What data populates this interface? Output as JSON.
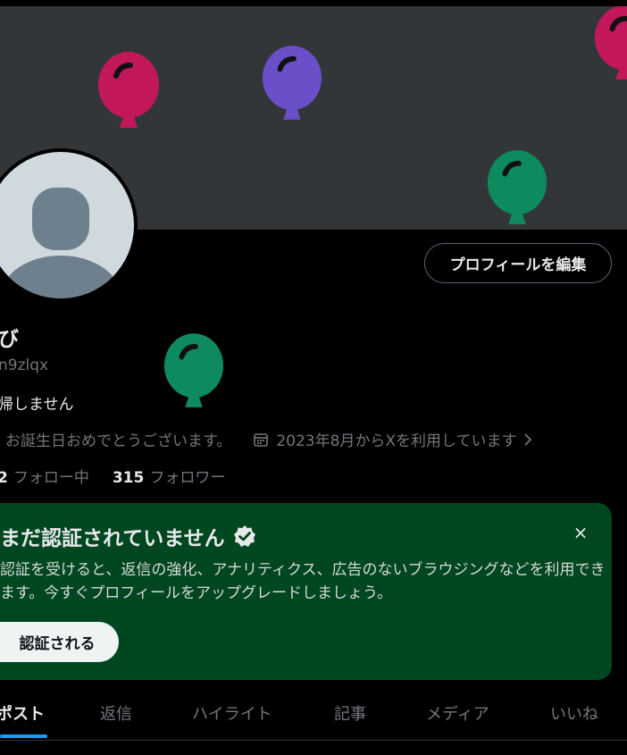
{
  "profile": {
    "display_name": "び",
    "handle": "n9zlqx",
    "bio": "帰しません",
    "edit_profile_label": "プロフィールを編集",
    "birthday_text": "お誕生日おめでとうございます。",
    "joined_text": "2023年8月からXを利用しています",
    "following_count": "2",
    "following_label": "フォロー中",
    "followers_count": "315",
    "followers_label": "フォロワー"
  },
  "verify_card": {
    "title": "まだ認証されていません",
    "description": "認証を受けると、返信の強化、アナリティクス、広告のないブラウジングなどを利用できます。今すぐプロフィールをアップグレードしましょう。",
    "button_label": "認証される",
    "close_icon": "×"
  },
  "tabs": [
    {
      "label": "ポスト",
      "active": true
    },
    {
      "label": "返信",
      "active": false
    },
    {
      "label": "ハイライト",
      "active": false
    },
    {
      "label": "記事",
      "active": false
    },
    {
      "label": "メディア",
      "active": false
    },
    {
      "label": "いいね",
      "active": false
    }
  ],
  "colors": {
    "accent": "#1d9bf0",
    "verify_bg": "#00461f",
    "balloon_pink": "#c2185b",
    "balloon_purple": "#6a4fc8",
    "balloon_green": "#0e8a5f"
  },
  "icons": {
    "balloon": "balloon-icon",
    "avatar": "default-avatar-icon",
    "calendar": "calendar-icon",
    "chevron": "chevron-right-icon",
    "verified": "verified-badge-icon",
    "close": "close-icon"
  }
}
